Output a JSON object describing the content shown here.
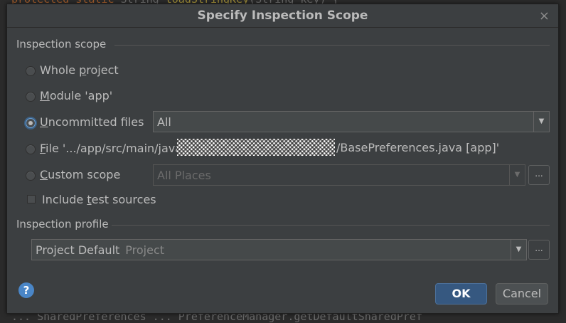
{
  "background_code": {
    "line1": [
      "protected static ",
      "String ",
      "toadStringKey",
      "(String key) {"
    ],
    "line2": "...  SharedPreferences  ...  PreferenceManager.getDefaultSharedPref"
  },
  "dialog": {
    "title": "Specify Inspection Scope",
    "close_icon": "×"
  },
  "inspection_scope": {
    "section_title": "Inspection scope",
    "options": {
      "whole_project": {
        "pre": "Whole ",
        "mnemonic": "p",
        "post": "roject"
      },
      "module": {
        "pre": "",
        "mnemonic": "M",
        "post": "odule 'app'"
      },
      "uncommitted": {
        "pre": "",
        "mnemonic": "U",
        "post": "ncommitted files"
      },
      "file": {
        "pre": "",
        "mnemonic": "F",
        "post": "ile '.../app/src/main/java",
        "tail": "/BasePreferences.java [app]'"
      },
      "custom": {
        "pre": "",
        "mnemonic": "C",
        "post": "ustom scope"
      }
    },
    "selected_option": "uncommitted",
    "uncommitted_select_value": "All",
    "custom_scope_value": "All Places",
    "include_test_sources": {
      "pre": "Include ",
      "mnemonic": "t",
      "post": "est sources",
      "checked": false
    },
    "ellipsis": "..."
  },
  "inspection_profile": {
    "section_title": "Inspection profile",
    "profile_name": "Project Default",
    "profile_scope": "Project",
    "ellipsis": "..."
  },
  "footer": {
    "help_icon": "?",
    "ok_label": "OK",
    "cancel_label": "Cancel"
  },
  "colors": {
    "dialog_bg": "#3c3f41",
    "accent_ok": "#365880",
    "help_blue": "#4a86c7"
  }
}
